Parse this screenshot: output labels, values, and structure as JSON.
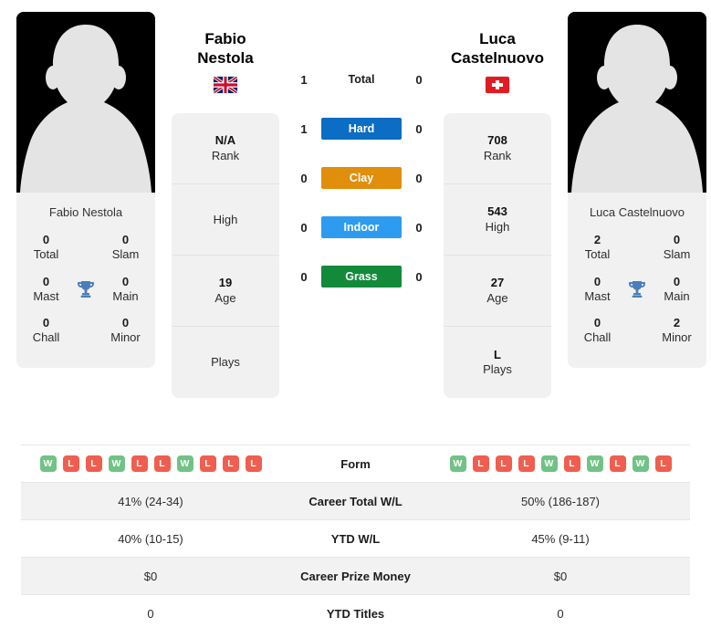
{
  "players": {
    "left": {
      "name": "Fabio\nNestola",
      "photo_caption": "Fabio Nestola",
      "country_flag": "uk-flag",
      "titles": [
        {
          "value": "0",
          "label": "Total"
        },
        {
          "value": "0",
          "label": "Slam"
        },
        {
          "value": "0",
          "label": "Mast"
        },
        {
          "value": "0",
          "label": "Main"
        },
        {
          "value": "0",
          "label": "Chall"
        },
        {
          "value": "0",
          "label": "Minor"
        }
      ],
      "info": [
        {
          "value": "N/A",
          "label": "Rank"
        },
        {
          "value": "",
          "label": "High"
        },
        {
          "value": "19",
          "label": "Age"
        },
        {
          "value": "",
          "label": "Plays"
        }
      ],
      "h2h": {
        "total": "1",
        "hard": "1",
        "clay": "0",
        "indoor": "0",
        "grass": "0"
      },
      "form": [
        "W",
        "L",
        "L",
        "W",
        "L",
        "L",
        "W",
        "L",
        "L",
        "L"
      ],
      "career_total_wl": "41% (24-34)",
      "ytd_wl": "40% (10-15)",
      "career_prize_money": "$0",
      "ytd_titles": "0"
    },
    "right": {
      "name": "Luca\nCastelnuovo",
      "photo_caption": "Luca Castelnuovo",
      "country_flag": "switzerland-flag",
      "titles": [
        {
          "value": "2",
          "label": "Total"
        },
        {
          "value": "0",
          "label": "Slam"
        },
        {
          "value": "0",
          "label": "Mast"
        },
        {
          "value": "0",
          "label": "Main"
        },
        {
          "value": "0",
          "label": "Chall"
        },
        {
          "value": "2",
          "label": "Minor"
        }
      ],
      "info": [
        {
          "value": "708",
          "label": "Rank"
        },
        {
          "value": "543",
          "label": "High"
        },
        {
          "value": "27",
          "label": "Age"
        },
        {
          "value": "L",
          "label": "Plays"
        }
      ],
      "h2h": {
        "total": "0",
        "hard": "0",
        "clay": "0",
        "indoor": "0",
        "grass": "0"
      },
      "form": [
        "W",
        "L",
        "L",
        "L",
        "W",
        "L",
        "W",
        "L",
        "W",
        "L"
      ],
      "career_total_wl": "50% (186-187)",
      "ytd_wl": "45% (9-11)",
      "career_prize_money": "$0",
      "ytd_titles": "0"
    }
  },
  "surfaces": [
    {
      "key": "total",
      "label": "Total",
      "color": "transparent",
      "plain": true
    },
    {
      "key": "hard",
      "label": "Hard",
      "color": "#0b6dc4",
      "plain": false
    },
    {
      "key": "clay",
      "label": "Clay",
      "color": "#e08e0b",
      "plain": false
    },
    {
      "key": "indoor",
      "label": "Indoor",
      "color": "#2d9bf0",
      "plain": false
    },
    {
      "key": "grass",
      "label": "Grass",
      "color": "#128a3a",
      "plain": false
    }
  ],
  "table_labels": {
    "form": "Form",
    "career_total_wl": "Career Total W/L",
    "ytd_wl": "YTD W/L",
    "career_prize_money": "Career Prize Money",
    "ytd_titles": "YTD Titles"
  },
  "colors": {
    "win": "#71c285",
    "loss": "#ef5e4e",
    "card_bg": "#f1f1f1",
    "row_alt_bg": "#f2f2f2",
    "trophy": "#4a7ebb"
  }
}
